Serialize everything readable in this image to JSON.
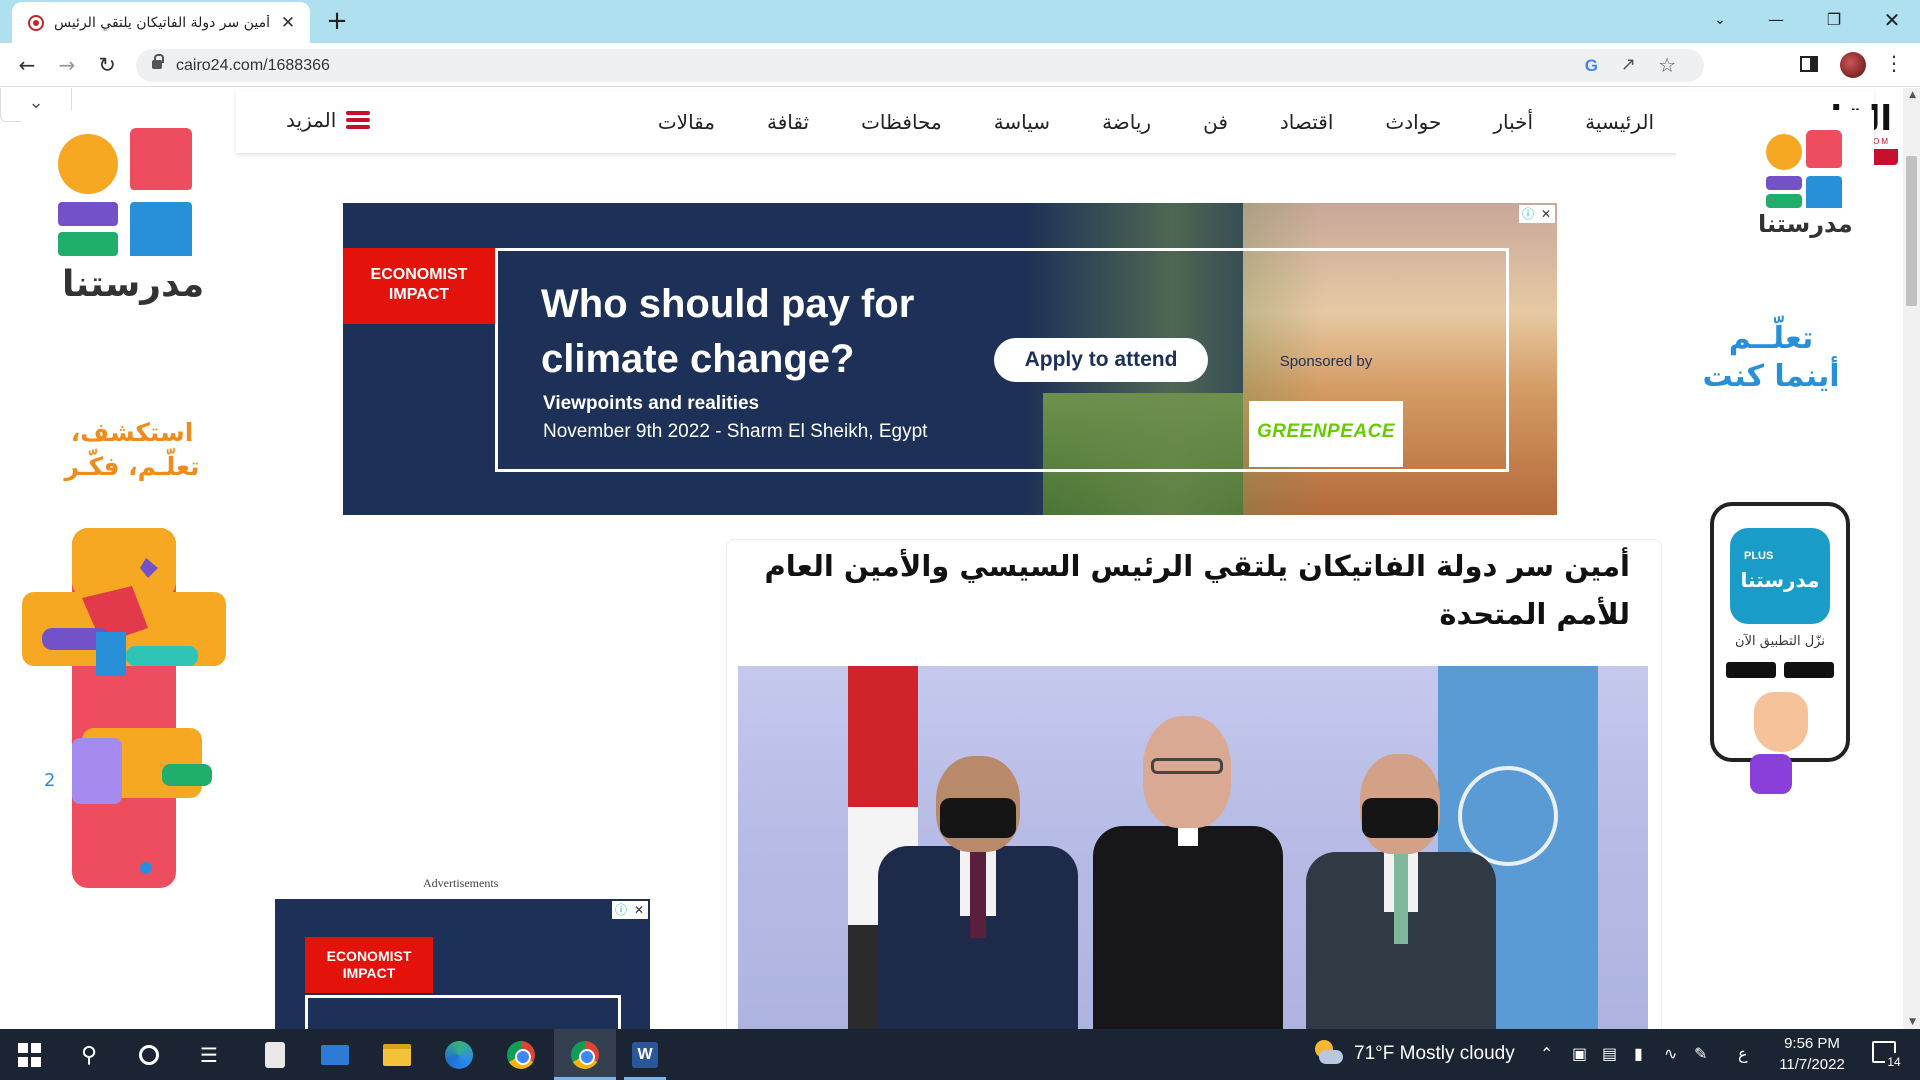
{
  "browser": {
    "tab_title": "أمين سر دولة الفاتيكان يلتقي الرئيس",
    "tab_close": "✕",
    "new_tab": "+",
    "url": "cairo24.com/1688366",
    "window_controls": {
      "search_tabs": "⌄",
      "minimize": "—",
      "restore": "❐",
      "close": "✕"
    },
    "icons": [
      "back-icon",
      "forward-icon",
      "reload-icon",
      "lock-icon",
      "google-icon",
      "share-icon",
      "star-icon",
      "side-panel-icon",
      "profile-avatar",
      "menu-icon"
    ]
  },
  "site": {
    "logo_text": "القاهرة",
    "logo_badge": "24",
    "logo_subtext": "CAIRO 24.COM",
    "nav": [
      "الرئيسية",
      "أخبار",
      "حوادث",
      "اقتصاد",
      "فن",
      "رياضة",
      "سياسة",
      "محافظات",
      "ثقافة",
      "مقالات"
    ],
    "more_label": "المزيد",
    "accent_color": "#c8102e"
  },
  "left_ad": {
    "brand": "مدرستنا",
    "slogan_line1": "استكشف،",
    "slogan_line2": "تعلّـم، فكّـر"
  },
  "right_ad": {
    "brand": "مدرستنا",
    "slogan_line1": "تعلّــم",
    "slogan_line2": "أينما كنت",
    "app_label_plus": "PLUS",
    "app_name": "مدرستنا",
    "cta": "نزّل التطبيق الآن"
  },
  "top_banner": {
    "badge_line1": "ECONOMIST",
    "badge_line2": "IMPACT",
    "headline": "Who should pay for climate change?",
    "sub1": "Viewpoints and realities",
    "sub2": "November 9th 2022 - Sharm El Sheikh, Egypt",
    "button": "Apply to attend",
    "sponsored_by": "Sponsored by",
    "sponsor": "GREENPEACE"
  },
  "side_ad": {
    "label": "Advertisements",
    "badge_line1": "ECONOMIST",
    "badge_line2": "IMPACT"
  },
  "article": {
    "title": "أمين سر دولة الفاتيكان يلتقي الرئيس السيسي والأمين العام للأمم المتحدة"
  },
  "taskbar": {
    "weather": "71°F  Mostly cloudy",
    "lang": "ع",
    "time": "9:56 PM",
    "date": "11/7/2022",
    "notifications": "14"
  }
}
